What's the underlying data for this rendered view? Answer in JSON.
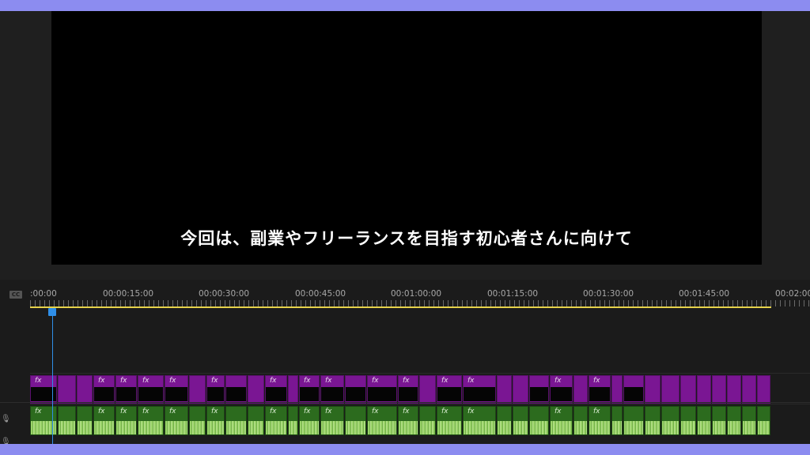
{
  "monitor": {
    "subtitle": "今回は、副業やフリーランスを目指す初心者さんに向けて"
  },
  "timeline": {
    "cc_label": "CC",
    "timecodes": [
      ":00:00",
      "00:00:15:00",
      "00:00:30:00",
      "00:00:45:00",
      "00:01:00:00",
      "00:01:15:00",
      "00:01:30:00",
      "00:01:45:00",
      "00:02:00"
    ],
    "fx_label": "fx"
  },
  "colors": {
    "video_clip": "#7a1693",
    "audio_clip": "#2c6b1e",
    "playhead": "#2f8fe8",
    "work_area_bar": "#e6d24a",
    "outer_frame": "#8c8cf0"
  },
  "icons": {
    "audio_track": "microphone-icon"
  }
}
